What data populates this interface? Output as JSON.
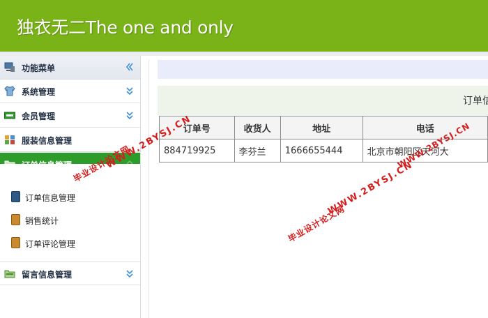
{
  "header": {
    "title": "独衣无二The one and only"
  },
  "sidebar": {
    "menu_title": "功能菜单",
    "items": [
      {
        "label": "系统管理"
      },
      {
        "label": "会员管理"
      },
      {
        "label": "服装信息管理"
      },
      {
        "label": "订单信息管理"
      },
      {
        "label": "留言信息管理"
      }
    ],
    "submenu": [
      {
        "label": "订单信息管理"
      },
      {
        "label": "销售统计"
      },
      {
        "label": "订单评论管理"
      }
    ]
  },
  "main": {
    "title": "订单信",
    "table": {
      "headers": [
        "订单号",
        "收货人",
        "地址",
        "电话"
      ],
      "rows": [
        [
          "884719925",
          "李芬兰",
          "1666655444",
          "北京市朝阳区天河大"
        ]
      ]
    }
  },
  "watermark": {
    "site": "WWW.2BYSJ.CN",
    "name": "毕业设计论文网"
  },
  "colors": {
    "header_bg": "#7ab317",
    "active_menu_bg": "#2e9c2b",
    "watermark": "#d3201f"
  }
}
